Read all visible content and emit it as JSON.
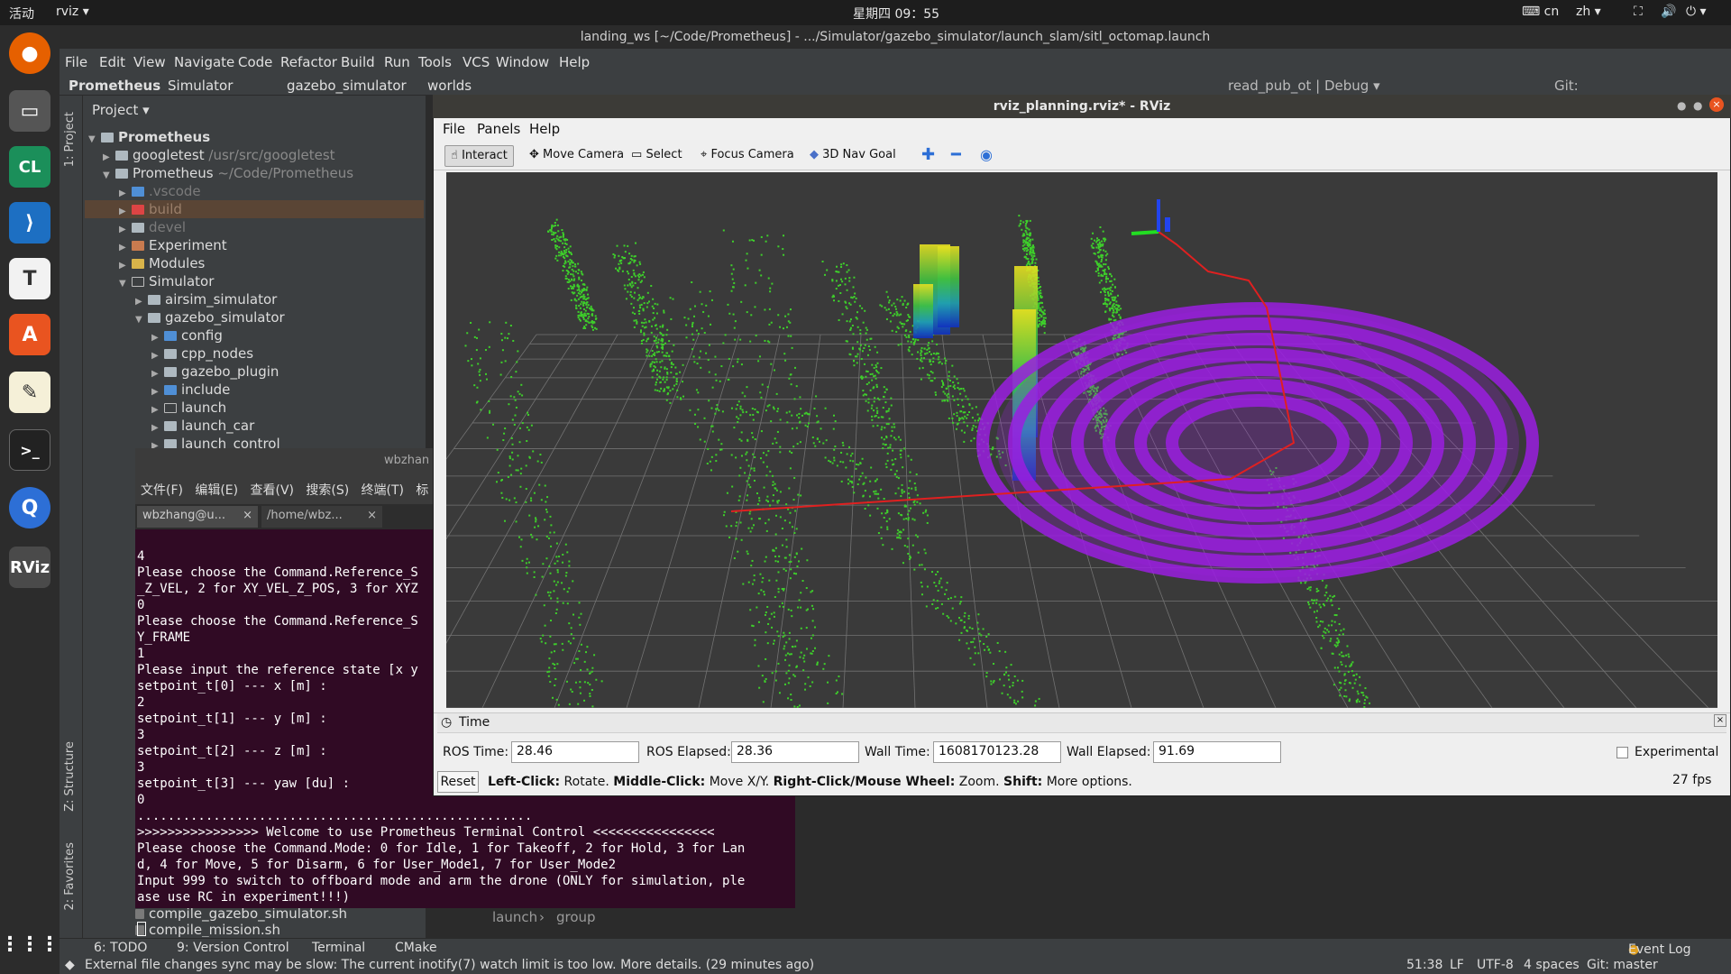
{
  "topbar": {
    "activities": "活动",
    "app": "rviz ▾",
    "clock": "星期四 09：55",
    "ime": "cn",
    "lang": "zh ▾"
  },
  "ide": {
    "title": "landing_ws [~/Code/Prometheus] - .../Simulator/gazebo_simulator/launch_slam/sitl_octomap.launch",
    "menu": [
      "File",
      "Edit",
      "View",
      "Navigate",
      "Code",
      "Refactor",
      "Build",
      "Run",
      "Tools",
      "VCS",
      "Window",
      "Help"
    ],
    "breadcrumb": [
      "Prometheus",
      "Simulator",
      "gazebo_simulator",
      "worlds"
    ],
    "run_config": "read_pub_ot | Debug ▾",
    "git_label": "Git:",
    "project_label": "Project ▾",
    "side_tab_project": "1: Project",
    "side_tab_structure": "Z: Structure",
    "side_tab_favorites": "2: Favorites",
    "tree": [
      {
        "label": "Prometheus",
        "hint": ""
      },
      {
        "label": "googletest",
        "hint": "/usr/src/googletest"
      },
      {
        "label": "Prometheus",
        "hint": "~/Code/Prometheus"
      },
      {
        "label": ".vscode",
        "hint": ""
      },
      {
        "label": "build",
        "hint": ""
      },
      {
        "label": "devel",
        "hint": ""
      },
      {
        "label": "Experiment",
        "hint": ""
      },
      {
        "label": "Modules",
        "hint": ""
      },
      {
        "label": "Simulator",
        "hint": ""
      },
      {
        "label": "airsim_simulator",
        "hint": ""
      },
      {
        "label": "gazebo_simulator",
        "hint": ""
      },
      {
        "label": "config",
        "hint": ""
      },
      {
        "label": "cpp_nodes",
        "hint": ""
      },
      {
        "label": "gazebo_plugin",
        "hint": ""
      },
      {
        "label": "include",
        "hint": ""
      },
      {
        "label": "launch",
        "hint": ""
      },
      {
        "label": "launch_car",
        "hint": ""
      },
      {
        "label": "launch_control",
        "hint": ""
      }
    ],
    "files_below": [
      "compile_gazebo_simulator.sh",
      "compile_mission.sh"
    ],
    "editor_crumbs": [
      "launch",
      "group"
    ],
    "bottom_tabs": [
      "6: TODO",
      "9: Version Control",
      "Terminal",
      "CMake"
    ],
    "event_log": "Event Log",
    "status_msg": "External file changes sync may be slow: The current inotify(7) watch limit is too low. More details. (29 minutes ago)",
    "status_right": {
      "pos": "51:38",
      "eol": "LF",
      "enc": "UTF-8",
      "indent": "4 spaces",
      "git": "Git: master"
    }
  },
  "terminal": {
    "title": "wbzhan",
    "menu": [
      "文件(F)",
      "编辑(E)",
      "查看(V)",
      "搜索(S)",
      "终端(T)",
      "标"
    ],
    "tabs": [
      "wbzhang@u...",
      "/home/wbz..."
    ],
    "lines": [
      "4",
      "Please choose the Command.Reference_S",
      "_Z_VEL, 2 for XY_VEL_Z_POS, 3 for XYZ",
      "0",
      "Please choose the Command.Reference_S",
      "Y_FRAME",
      "1",
      "Please input the reference state [x y",
      "setpoint_t[0] --- x [m] :",
      "2",
      "setpoint_t[1] --- y [m] :",
      "3",
      "setpoint_t[2] --- z [m] :",
      "3",
      "setpoint_t[3] --- yaw [du] :",
      "0",
      "....................................................",
      ">>>>>>>>>>>>>>>> Welcome to use Prometheus Terminal Control <<<<<<<<<<<<<<<<",
      "Please choose the Command.Mode: 0 for Idle, 1 for Takeoff, 2 for Hold, 3 for Lan",
      "d, 4 for Move, 5 for Disarm, 6 for User_Mode1, 7 for User_Mode2",
      "Input 999 to switch to offboard mode and arm the drone (ONLY for simulation, ple",
      "ase use RC in experiment!!!)"
    ]
  },
  "rviz": {
    "title": "rviz_planning.rviz* - RViz",
    "menu": [
      "File",
      "Panels",
      "Help"
    ],
    "tools": [
      "Interact",
      "Move Camera",
      "Select",
      "Focus Camera",
      "3D Nav Goal"
    ],
    "time_panel": {
      "title": "Time",
      "ros_time_label": "ROS Time:",
      "ros_time": "28.46",
      "ros_elapsed_label": "ROS Elapsed:",
      "ros_elapsed": "28.36",
      "wall_time_label": "Wall Time:",
      "wall_time": "1608170123.28",
      "wall_elapsed_label": "Wall Elapsed:",
      "wall_elapsed": "91.69",
      "experimental": "Experimental",
      "reset": "Reset",
      "hint_b1": "Left-Click:",
      "hint_t1": " Rotate. ",
      "hint_b2": "Middle-Click:",
      "hint_t2": " Move X/Y. ",
      "hint_b3": "Right-Click/Mouse Wheel:",
      "hint_t3": " Zoom. ",
      "hint_b4": "Shift:",
      "hint_t4": " More options.",
      "fps": "27 fps"
    }
  },
  "colors": {
    "points": "#3ecf2b",
    "octomap": "#9a1fe0",
    "path": "#e02020",
    "grid": "#8a8a8a"
  }
}
